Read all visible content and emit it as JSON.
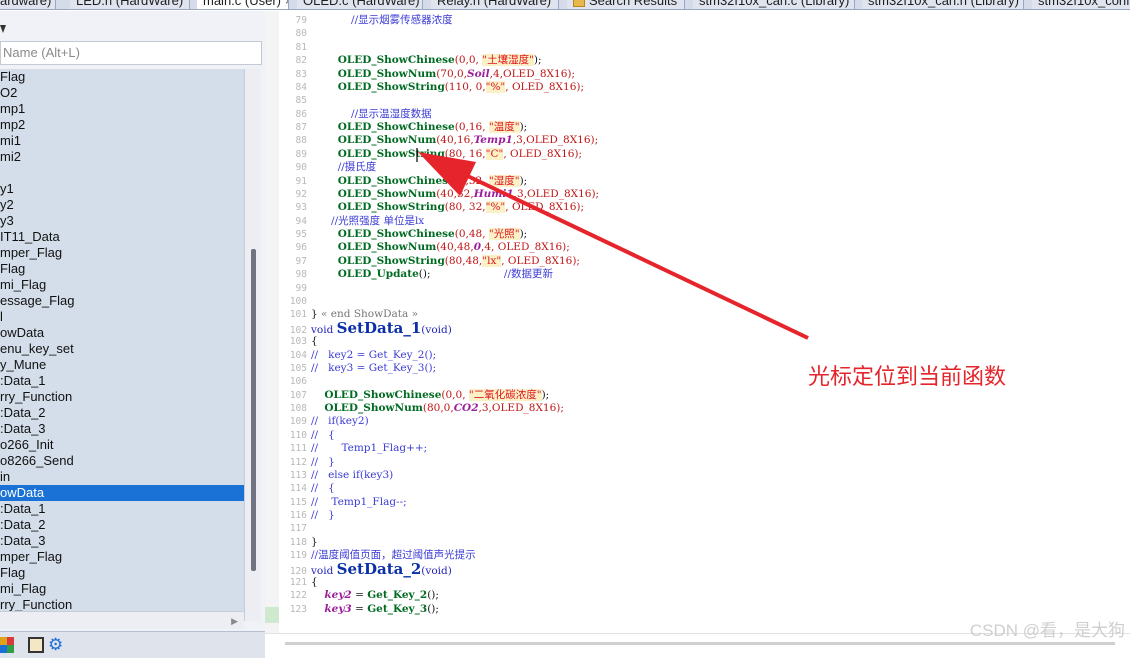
{
  "tabs": [
    {
      "label": "ardware)",
      "active": false
    },
    {
      "label": "LED.h (HardWare)",
      "active": false
    },
    {
      "label": "main.c (User)",
      "active": true,
      "close": "×"
    },
    {
      "label": "OLED.c (HardWare)",
      "active": false
    },
    {
      "label": "Relay.h (HardWare)",
      "active": false
    },
    {
      "label": "Search Results",
      "active": false,
      "icon": "search-results-icon"
    },
    {
      "label": "stm32f10x_can.c (Library)",
      "active": false
    },
    {
      "label": "stm32f10x_can.h (Library)",
      "active": false
    },
    {
      "label": "stm32f10x_conf",
      "active": false
    }
  ],
  "function_panel": {
    "search_placeholder": "Name (Alt+L)",
    "items": [
      "Flag",
      "O2",
      "mp1",
      "mp2",
      "mi1",
      "mi2",
      "",
      "y1",
      "y2",
      "y3",
      "IT11_Data",
      "mper_Flag",
      "Flag",
      "mi_Flag",
      "essage_Flag",
      "l",
      "owData",
      "enu_key_set",
      "y_Mune",
      ":Data_1",
      "rry_Function",
      ":Data_2",
      ":Data_3",
      "o266_Init",
      "o8266_Send",
      "in",
      "owData",
      ":Data_1",
      ":Data_2",
      ":Data_3",
      "mper_Flag",
      "Flag",
      "mi_Flag",
      "rry_Function"
    ],
    "selected_index": 26,
    "tools": [
      "colored-grid-icon",
      "book-icon",
      "gear-icon"
    ]
  },
  "editor": {
    "lines": [
      {
        "n": "79",
        "tokens": [
          {
            "t": "            //显示烟雾传感器浓度",
            "c": "comment"
          }
        ]
      },
      {
        "n": "80",
        "tokens": []
      },
      {
        "n": "81",
        "tokens": []
      },
      {
        "n": "82",
        "tokens": [
          {
            "t": "        ",
            "c": "plain"
          },
          {
            "t": "OLED_ShowChinese",
            "c": "fn"
          },
          {
            "t": "(0,0, ",
            "c": "num"
          },
          {
            "t": "\"土壤湿度\"",
            "c": "str"
          },
          {
            "t": ");",
            "c": "plain"
          }
        ]
      },
      {
        "n": "83",
        "tokens": [
          {
            "t": "        ",
            "c": "plain"
          },
          {
            "t": "OLED_ShowNum",
            "c": "fn"
          },
          {
            "t": "(70,0,",
            "c": "num"
          },
          {
            "t": "Soil",
            "c": "var"
          },
          {
            "t": ",4,OLED_8X16);",
            "c": "macro"
          }
        ]
      },
      {
        "n": "84",
        "tokens": [
          {
            "t": "        ",
            "c": "plain"
          },
          {
            "t": "OLED_ShowString",
            "c": "fn"
          },
          {
            "t": "(110, 0,",
            "c": "num"
          },
          {
            "t": "\"%\"",
            "c": "str"
          },
          {
            "t": ", OLED_8X16);",
            "c": "macro"
          }
        ]
      },
      {
        "n": "85",
        "tokens": []
      },
      {
        "n": "86",
        "tokens": [
          {
            "t": "            //显示温湿度数据",
            "c": "comment"
          }
        ]
      },
      {
        "n": "87",
        "tokens": [
          {
            "t": "        ",
            "c": "plain"
          },
          {
            "t": "OLED_ShowChinese",
            "c": "fn"
          },
          {
            "t": "(0,16, ",
            "c": "num"
          },
          {
            "t": "\"温度\"",
            "c": "str"
          },
          {
            "t": ");",
            "c": "plain"
          }
        ]
      },
      {
        "n": "88",
        "tokens": [
          {
            "t": "        ",
            "c": "plain"
          },
          {
            "t": "OLED_ShowNum",
            "c": "fn"
          },
          {
            "t": "(40,16,",
            "c": "num"
          },
          {
            "t": "Temp1",
            "c": "var"
          },
          {
            "t": ",3,OLED_8X16);",
            "c": "macro"
          }
        ]
      },
      {
        "n": "89",
        "tokens": [
          {
            "t": "        ",
            "c": "plain"
          },
          {
            "t": "OLED_ShowString",
            "c": "fn"
          },
          {
            "t": "(80, 16,",
            "c": "num"
          },
          {
            "t": "\"C\"",
            "c": "str"
          },
          {
            "t": ", OLED_8X16);",
            "c": "macro"
          }
        ]
      },
      {
        "n": "90",
        "tokens": [
          {
            "t": "        //摄氏度",
            "c": "comment"
          }
        ]
      },
      {
        "n": "91",
        "tokens": [
          {
            "t": "        ",
            "c": "plain"
          },
          {
            "t": "OLED_ShowChinese",
            "c": "fn"
          },
          {
            "t": "(0,32, ",
            "c": "num"
          },
          {
            "t": "\"湿度\"",
            "c": "str"
          },
          {
            "t": ");",
            "c": "plain"
          }
        ]
      },
      {
        "n": "92",
        "tokens": [
          {
            "t": "        ",
            "c": "plain"
          },
          {
            "t": "OLED_ShowNum",
            "c": "fn"
          },
          {
            "t": "(40,32,",
            "c": "num"
          },
          {
            "t": "Humi1",
            "c": "var"
          },
          {
            "t": ",3,OLED_8X16);",
            "c": "macro"
          }
        ]
      },
      {
        "n": "93",
        "tokens": [
          {
            "t": "        ",
            "c": "plain"
          },
          {
            "t": "OLED_ShowString",
            "c": "fn"
          },
          {
            "t": "(80, 32,",
            "c": "num"
          },
          {
            "t": "\"%\"",
            "c": "str"
          },
          {
            "t": ", OLED_8X16);",
            "c": "macro"
          }
        ]
      },
      {
        "n": "94",
        "tokens": [
          {
            "t": "      //光照强度 单位是lx",
            "c": "comment"
          }
        ]
      },
      {
        "n": "95",
        "tokens": [
          {
            "t": "        ",
            "c": "plain"
          },
          {
            "t": "OLED_ShowChinese",
            "c": "fn"
          },
          {
            "t": "(0,48, ",
            "c": "num"
          },
          {
            "t": "\"光照\"",
            "c": "str"
          },
          {
            "t": ");",
            "c": "plain"
          }
        ]
      },
      {
        "n": "96",
        "tokens": [
          {
            "t": "        ",
            "c": "plain"
          },
          {
            "t": "OLED_ShowNum",
            "c": "fn"
          },
          {
            "t": "(40,48,",
            "c": "num"
          },
          {
            "t": "0",
            "c": "var"
          },
          {
            "t": ",4, OLED_8X16);",
            "c": "macro"
          }
        ]
      },
      {
        "n": "97",
        "tokens": [
          {
            "t": "        ",
            "c": "plain"
          },
          {
            "t": "OLED_ShowString",
            "c": "fn"
          },
          {
            "t": "(80,48,",
            "c": "num"
          },
          {
            "t": "\"lx\"",
            "c": "str"
          },
          {
            "t": ", OLED_8X16);",
            "c": "macro"
          }
        ]
      },
      {
        "n": "98",
        "tokens": [
          {
            "t": "        ",
            "c": "plain"
          },
          {
            "t": "OLED_Update",
            "c": "fn"
          },
          {
            "t": "();",
            "c": "plain"
          },
          {
            "t": "                      //数据更新",
            "c": "comment"
          }
        ]
      },
      {
        "n": "99",
        "tokens": []
      },
      {
        "n": "100",
        "tokens": []
      },
      {
        "n": "101",
        "tokens": [
          {
            "t": "} ",
            "c": "plain"
          },
          {
            "t": "« end ShowData »",
            "c": "gray"
          }
        ]
      },
      {
        "n": "102",
        "big": true,
        "tokens": [
          {
            "t": "void ",
            "c": "kw"
          },
          {
            "t": "SetData_1",
            "c": "def"
          },
          {
            "t": "(void)",
            "c": "kw"
          }
        ]
      },
      {
        "n": "103",
        "tokens": [
          {
            "t": "{",
            "c": "plain"
          }
        ]
      },
      {
        "n": "104",
        "tokens": [
          {
            "t": "//   key2 = Get_Key_2();",
            "c": "comment"
          }
        ]
      },
      {
        "n": "105",
        "tokens": [
          {
            "t": "//   key3 = Get_Key_3();",
            "c": "comment"
          }
        ]
      },
      {
        "n": "106",
        "tokens": []
      },
      {
        "n": "107",
        "tokens": [
          {
            "t": "    ",
            "c": "plain"
          },
          {
            "t": "OLED_ShowChinese",
            "c": "fn"
          },
          {
            "t": "(0,0, ",
            "c": "num"
          },
          {
            "t": "\"二氧化碳浓度\"",
            "c": "str"
          },
          {
            "t": ");",
            "c": "plain"
          }
        ]
      },
      {
        "n": "108",
        "tokens": [
          {
            "t": "    ",
            "c": "plain"
          },
          {
            "t": "OLED_ShowNum",
            "c": "fn"
          },
          {
            "t": "(80,0,",
            "c": "num"
          },
          {
            "t": "CO2",
            "c": "var"
          },
          {
            "t": ",3,OLED_8X16);",
            "c": "macro"
          }
        ]
      },
      {
        "n": "109",
        "tokens": [
          {
            "t": "//   if(key2)",
            "c": "comment"
          }
        ]
      },
      {
        "n": "110",
        "tokens": [
          {
            "t": "//   {",
            "c": "comment"
          }
        ]
      },
      {
        "n": "111",
        "tokens": [
          {
            "t": "//       Temp1_Flag++;",
            "c": "comment"
          }
        ]
      },
      {
        "n": "112",
        "tokens": [
          {
            "t": "//   }",
            "c": "comment"
          }
        ]
      },
      {
        "n": "113",
        "tokens": [
          {
            "t": "//   else if(key3)",
            "c": "comment"
          }
        ]
      },
      {
        "n": "114",
        "tokens": [
          {
            "t": "//   {",
            "c": "comment"
          }
        ]
      },
      {
        "n": "115",
        "tokens": [
          {
            "t": "//    Temp1_Flag--;",
            "c": "comment"
          }
        ]
      },
      {
        "n": "116",
        "tokens": [
          {
            "t": "//   }",
            "c": "comment"
          }
        ]
      },
      {
        "n": "117",
        "tokens": []
      },
      {
        "n": "118",
        "tokens": [
          {
            "t": "}",
            "c": "plain"
          }
        ]
      },
      {
        "n": "119",
        "tokens": [
          {
            "t": "//温度阈值页面，超过阈值声光提示",
            "c": "comment"
          }
        ]
      },
      {
        "n": "120",
        "big": true,
        "tokens": [
          {
            "t": "void ",
            "c": "kw"
          },
          {
            "t": "SetData_2",
            "c": "def"
          },
          {
            "t": "(void)",
            "c": "kw"
          }
        ]
      },
      {
        "n": "121",
        "tokens": [
          {
            "t": "{",
            "c": "plain"
          }
        ]
      },
      {
        "n": "122",
        "tokens": [
          {
            "t": "    ",
            "c": "plain"
          },
          {
            "t": "key2",
            "c": "var"
          },
          {
            "t": " = ",
            "c": "plain"
          },
          {
            "t": "Get_Key_2",
            "c": "fn"
          },
          {
            "t": "();",
            "c": "plain"
          }
        ]
      },
      {
        "n": "123",
        "tokens": [
          {
            "t": "    ",
            "c": "plain"
          },
          {
            "t": "key3",
            "c": "var"
          },
          {
            "t": " = ",
            "c": "plain"
          },
          {
            "t": "Get_Key_3",
            "c": "fn"
          },
          {
            "t": "();",
            "c": "plain"
          }
        ]
      }
    ]
  },
  "annotation": {
    "text": "光标定位到当前函数",
    "color": "#e5242b"
  },
  "watermark": "CSDN @看，是大狗"
}
